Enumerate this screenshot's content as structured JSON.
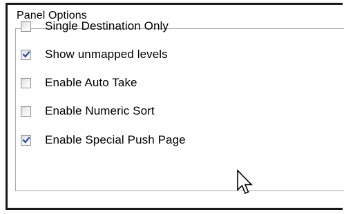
{
  "panel": {
    "title": "Panel Options"
  },
  "options": [
    {
      "label": "Single Destination Only",
      "checked": false
    },
    {
      "label": "Show unmapped levels",
      "checked": true
    },
    {
      "label": "Enable Auto Take",
      "checked": false
    },
    {
      "label": "Enable Numeric Sort",
      "checked": false
    },
    {
      "label": "Enable Special Push Page",
      "checked": true
    }
  ],
  "colors": {
    "checkmark": "#1f4fa8",
    "window_border": "#1a1a1a",
    "group_border": "#a9a9a9"
  },
  "icons": {
    "checkbox_mark": "check-icon",
    "pointer": "mouse-cursor-icon"
  }
}
